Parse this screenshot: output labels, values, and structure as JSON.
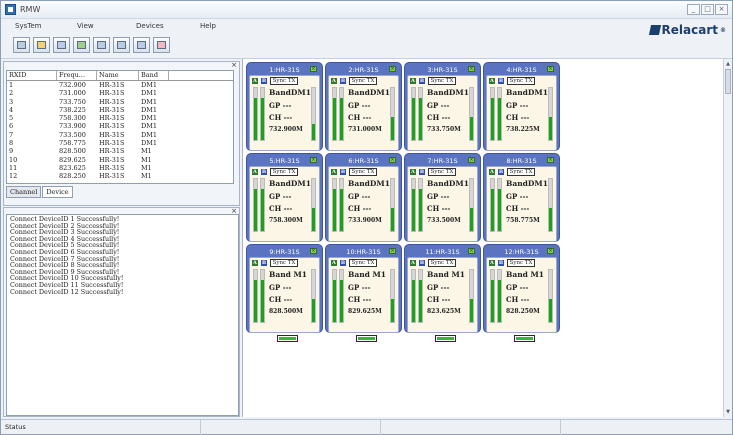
{
  "window": {
    "title": "RMW"
  },
  "menu": [
    "SysTem",
    "View",
    "Devices",
    "Help"
  ],
  "brand": "Relacart",
  "toolbar": [
    "monitor-icon",
    "display-icon",
    "chart-icon",
    "network-icon",
    "channel-icon",
    "band-icon",
    "device-icon",
    "help-icon"
  ],
  "device_table": {
    "headers": [
      "RXID",
      "Frequ...",
      "Name",
      "Band"
    ],
    "rows": [
      [
        "1",
        "732.900",
        "HR-31S",
        "DM1"
      ],
      [
        "2",
        "731.000",
        "HR-31S",
        "DM1"
      ],
      [
        "3",
        "733.750",
        "HR-31S",
        "DM1"
      ],
      [
        "4",
        "738.225",
        "HR-31S",
        "DM1"
      ],
      [
        "5",
        "758.300",
        "HR-31S",
        "DM1"
      ],
      [
        "6",
        "733.900",
        "HR-31S",
        "DM1"
      ],
      [
        "7",
        "733.500",
        "HR-31S",
        "DM1"
      ],
      [
        "8",
        "758.775",
        "HR-31S",
        "DM1"
      ],
      [
        "9",
        "828.500",
        "HR-31S",
        "M1"
      ],
      [
        "10",
        "829.625",
        "HR-31S",
        "M1"
      ],
      [
        "11",
        "823.625",
        "HR-31S",
        "M1"
      ],
      [
        "12",
        "828.250",
        "HR-31S",
        "M1"
      ]
    ]
  },
  "tabs": [
    "Channel",
    "Device"
  ],
  "log": [
    "Connect DeviceID 1 Successfully!",
    "Connect DeviceID 2 Successfully!",
    "Connect DeviceID 3 Successfully!",
    "Connect DeviceID 4 Successfully!",
    "Connect DeviceID 5 Successfully!",
    "Connect DeviceID 6 Successfully!",
    "Connect DeviceID 7 Successfully!",
    "Connect DeviceID 8 Successfully!",
    "Connect DeviceID 9 Successfully!",
    "Connect DeviceID 10 Successfully!",
    "Connect DeviceID 11 Successfully!",
    "Connect DeviceID 12 Successfully!"
  ],
  "cards": [
    {
      "title": "1:HR-31S",
      "band": "BandDM1",
      "gp": "GP ---",
      "ch": "CH ---",
      "freq": "732.900M",
      "sync": "Sync TX",
      "levels": [
        0.8,
        0.8,
        0.3
      ],
      "battery": 1
    },
    {
      "title": "2:HR-31S",
      "band": "BandDM1",
      "gp": "GP ---",
      "ch": "CH ---",
      "freq": "731.000M",
      "sync": "Sync TX",
      "levels": [
        0.8,
        0.8,
        0.45
      ],
      "battery": 1
    },
    {
      "title": "3:HR-31S",
      "band": "BandDM1",
      "gp": "GP ---",
      "ch": "CH ---",
      "freq": "733.750M",
      "sync": "Sync TX",
      "levels": [
        0.8,
        0.8,
        0.45
      ],
      "battery": 1
    },
    {
      "title": "4:HR-31S",
      "band": "BandDM1",
      "gp": "GP ---",
      "ch": "CH ---",
      "freq": "738.225M",
      "sync": "Sync TX",
      "levels": [
        0.8,
        0.8,
        0.45
      ],
      "battery": 1
    },
    {
      "title": "5:HR-31S",
      "band": "BandDM1",
      "gp": "GP ---",
      "ch": "CH ---",
      "freq": "758.300M",
      "sync": "Sync TX",
      "levels": [
        0.8,
        0.8,
        0.45
      ],
      "battery": 1
    },
    {
      "title": "6:HR-31S",
      "band": "BandDM1",
      "gp": "GP ---",
      "ch": "CH ---",
      "freq": "733.900M",
      "sync": "Sync TX",
      "levels": [
        0.8,
        0.8,
        0.45
      ],
      "battery": 1
    },
    {
      "title": "7:HR-31S",
      "band": "BandDM1",
      "gp": "GP ---",
      "ch": "CH ---",
      "freq": "733.500M",
      "sync": "Sync TX",
      "levels": [
        0.8,
        0.8,
        0.45
      ],
      "battery": 1
    },
    {
      "title": "8:HR-31S",
      "band": "BandDM1",
      "gp": "GP ---",
      "ch": "CH ---",
      "freq": "758.775M",
      "sync": "Sync TX",
      "levels": [
        0.8,
        0.8,
        0.45
      ],
      "battery": 1
    },
    {
      "title": "9:HR-31S",
      "band": "Band M1",
      "gp": "GP ---",
      "ch": "CH ---",
      "freq": "828.500M",
      "sync": "Sync TX",
      "levels": [
        0.8,
        0.8,
        0.45
      ],
      "battery": 1
    },
    {
      "title": "10:HR-31S",
      "band": "Band M1",
      "gp": "GP ---",
      "ch": "CH ---",
      "freq": "829.625M",
      "sync": "Sync TX",
      "levels": [
        0.8,
        0.8,
        0.45
      ],
      "battery": 1
    },
    {
      "title": "11:HR-31S",
      "band": "Band M1",
      "gp": "GP ---",
      "ch": "CH ---",
      "freq": "823.625M",
      "sync": "Sync TX",
      "levels": [
        0.8,
        0.8,
        0.45
      ],
      "battery": 1
    },
    {
      "title": "12:HR-31S",
      "band": "Band M1",
      "gp": "GP ---",
      "ch": "CH ---",
      "freq": "828.250M",
      "sync": "Sync TX",
      "levels": [
        0.8,
        0.8,
        0.45
      ],
      "battery": 1
    }
  ],
  "status": {
    "text": "Status"
  }
}
